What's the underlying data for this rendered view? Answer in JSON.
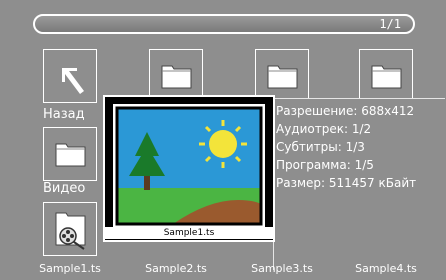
{
  "header": {
    "page_counter": "1/1"
  },
  "tiles": {
    "back_label": "Назад",
    "video_label": "Видео"
  },
  "files": [
    {
      "label": "Sample1.ts"
    },
    {
      "label": "Sample2.ts"
    },
    {
      "label": "Sample3.ts"
    },
    {
      "label": "Sample4.ts"
    }
  ],
  "preview": {
    "caption": "Sample1.ts"
  },
  "info": {
    "resolution": "Разрешение: 688x412",
    "audio": "Аудиотрек: 1/2",
    "subtitles": "Субтитры: 1/3",
    "program": "Программа: 1/5",
    "size": "Размер: 511457 кБайт"
  },
  "colors": {
    "background": "#8e8e8e",
    "border": "#ffffff",
    "sky": "#2b98d6",
    "grass": "#4bb543",
    "sun": "#f3e43a",
    "hill": "#9a5a2e"
  },
  "icons": [
    "back-arrow-icon",
    "folder-icon",
    "video-file-icon"
  ]
}
